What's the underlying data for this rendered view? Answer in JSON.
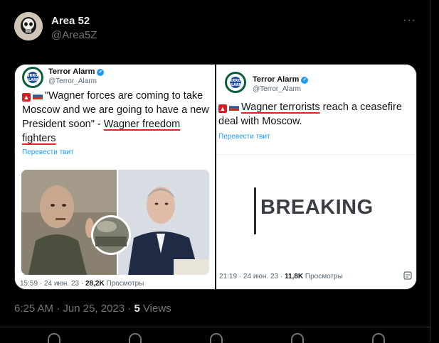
{
  "author": {
    "name": "Area 52",
    "handle": "@Area5Z"
  },
  "more_label": "···",
  "left_tweet": {
    "account_name": "Terror Alarm",
    "account_handle": "@Terror_Alarm",
    "logo_text": "TERROR ALARM",
    "text_before": "\"Wagner forces are coming to take Moscow and we are going to have a new President soon\" - ",
    "text_underlined": "Wagner freedom fighters",
    "translate": "Перевести твит",
    "time": "15:59 · 24 июн. 23 · ",
    "views_count": "28,2K",
    "views_label": " Просмотры"
  },
  "right_tweet": {
    "account_name": "Terror Alarm",
    "account_handle": "@Terror_Alarm",
    "logo_text": "TERROR ALARM",
    "text_underlined": "Wagner terrorists",
    "text_after": " reach a ceasefire deal with Moscow.",
    "translate": "Перевести твит",
    "breaking": "BREAKING",
    "time": "21:19 · 24 июн. 23 · ",
    "views_count": "11,8K",
    "views_label": " Просмотры"
  },
  "footer": {
    "datetime": "6:25 AM · Jun 25, 2023 · ",
    "views_count": "5",
    "views_label": " Views"
  },
  "colors": {
    "background": "#000000",
    "underline": "#e0261c",
    "link": "#1d9bf0",
    "verified": "#1d9bf0"
  }
}
